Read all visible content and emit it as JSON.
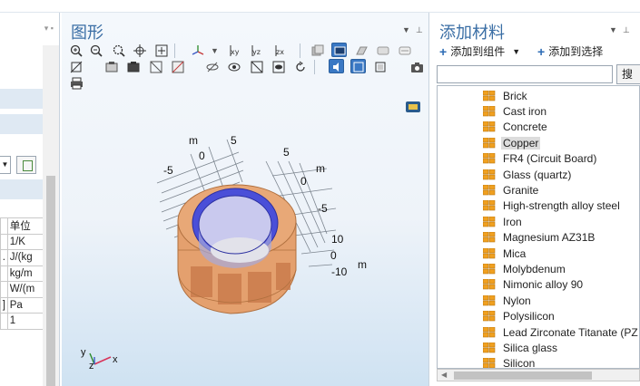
{
  "left_panel": {
    "table": {
      "header": "单位",
      "rows": [
        {
          "marker": "",
          "unit": "1/K"
        },
        {
          "marker": ".",
          "unit": "J/(kg"
        },
        {
          "marker": "",
          "unit": "kg/m"
        },
        {
          "marker": "",
          "unit": "W/(m"
        },
        {
          "marker": "]",
          "unit": "Pa"
        },
        {
          "marker": "",
          "unit": "1"
        }
      ]
    }
  },
  "graphics": {
    "title": "图形",
    "axis_labels": {
      "top_left_unit": "m",
      "top_left_5": "5",
      "top_left_0": "0",
      "top_left_m5": "-5",
      "top_right_5": "5",
      "top_right_unit": "m",
      "top_right_0": "0",
      "top_right_m5": "-5",
      "z_10": "10",
      "z_0": "0",
      "z_m10": "-10",
      "z_unit": "m"
    },
    "triad": {
      "x": "x",
      "y": "y",
      "z": "z"
    }
  },
  "add_material": {
    "title": "添加材料",
    "add_to_component": "添加到组件",
    "add_to_selection": "添加到选择",
    "search_value": "",
    "search_button": "搜",
    "materials": [
      "Brick",
      "Cast iron",
      "Concrete",
      "Copper",
      "FR4 (Circuit Board)",
      "Glass (quartz)",
      "Granite",
      "High-strength alloy steel",
      "Iron",
      "Magnesium AZ31B",
      "Mica",
      "Molybdenum",
      "Nimonic alloy 90",
      "Nylon",
      "Polysilicon",
      "Lead Zirconate Titanate (PZ",
      "Silica glass",
      "Silicon"
    ],
    "selected_index": 3
  },
  "colors": {
    "accent_title": "#3a6ea5",
    "coil_copper": "#d08a55",
    "tube_blue": "#3a3fd0",
    "toggle_active": "#3a78c4"
  }
}
